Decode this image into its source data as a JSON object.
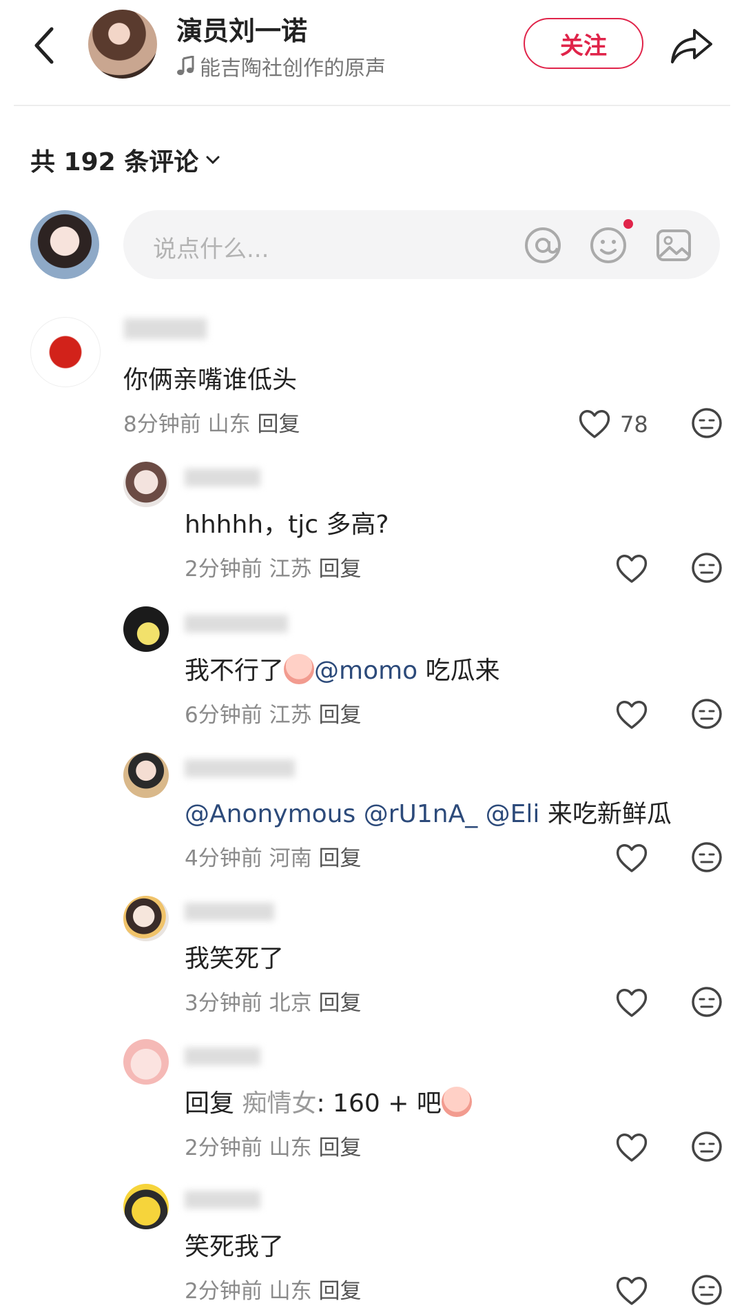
{
  "header": {
    "author_name": "演员刘一诺",
    "music": "能吉陶社创作的原声",
    "follow_label": "关注"
  },
  "comments_header": {
    "count_label": "共 192 条评论"
  },
  "input": {
    "placeholder": "说点什么..."
  },
  "top_comment": {
    "text": "你俩亲嘴谁低头",
    "time": "8分钟前",
    "location": "山东",
    "reply": "回复",
    "likes": "78"
  },
  "replies": [
    {
      "text": "hhhhh，tjc 多高?",
      "time": "2分钟前",
      "location": "江苏",
      "reply": "回复"
    },
    {
      "text_before": "我不行了",
      "mention": "@momo",
      "text_after": " 吃瓜来",
      "time": "6分钟前",
      "location": "江苏",
      "reply": "回复"
    },
    {
      "mention1": "@Anonymous",
      "mention2": "@rU1nA_",
      "mention3": "@Eli",
      "text_after": " 来吃新鲜瓜",
      "time": "4分钟前",
      "location": "河南",
      "reply": "回复"
    },
    {
      "text": "我笑死了",
      "time": "3分钟前",
      "location": "北京",
      "reply": "回复"
    },
    {
      "reply_prefix": "回复",
      "target": "痴情女",
      "text": ": 160 + 吧",
      "time": "2分钟前",
      "location": "山东",
      "reply": "回复"
    },
    {
      "text": "笑死我了",
      "time": "2分钟前",
      "location": "山东",
      "reply": "回复"
    }
  ],
  "colors": {
    "accent": "#e0244a",
    "mention": "#2c4a7a"
  }
}
